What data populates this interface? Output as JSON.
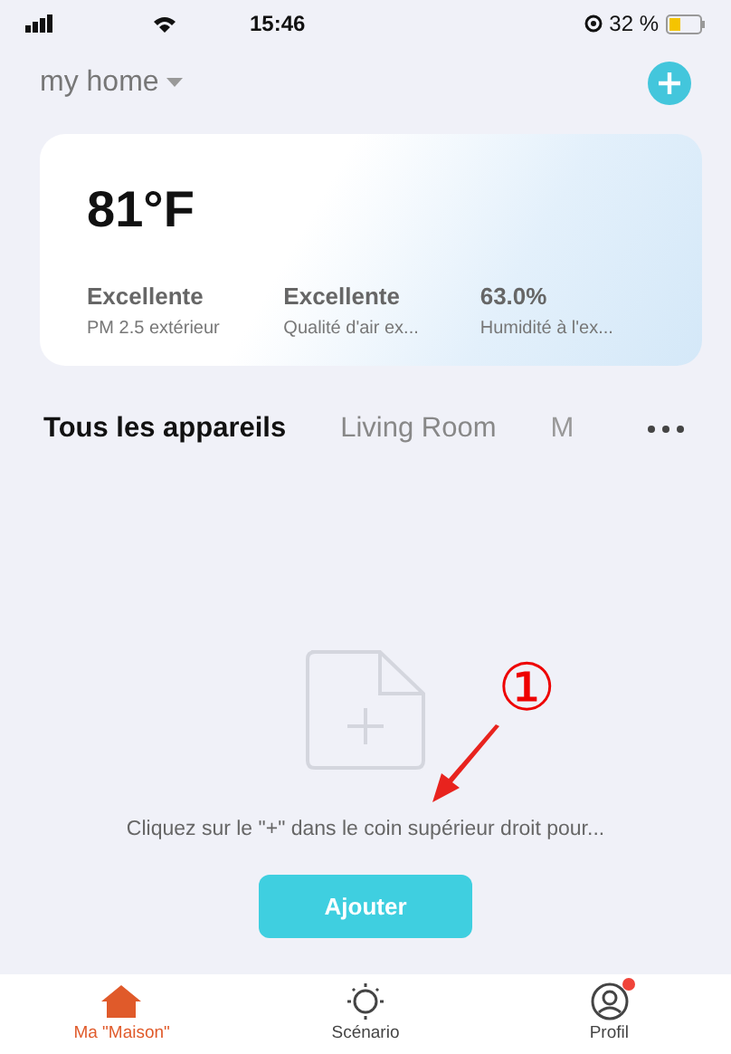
{
  "status_bar": {
    "time": "15:46",
    "battery": "32 %"
  },
  "header": {
    "home_name": "my home"
  },
  "weather_card": {
    "temperature": "81°F",
    "metrics": [
      {
        "value": "Excellente",
        "label": "PM 2.5 extérieur"
      },
      {
        "value": "Excellente",
        "label": "Qualité d'air ex..."
      },
      {
        "value": "63.0%",
        "label": "Humidité à l'ex..."
      }
    ]
  },
  "room_tabs": [
    {
      "label": "Tous les appareils",
      "selected": true
    },
    {
      "label": "Living Room",
      "selected": false
    },
    {
      "label": "M",
      "selected": false
    }
  ],
  "empty_state": {
    "message": "Cliquez sur le \"+\" dans le coin supérieur droit pour...",
    "button": "Ajouter"
  },
  "annotation": {
    "label": "①"
  },
  "bottom_nav": [
    {
      "label": "Ma \"Maison\"",
      "kind": "home",
      "selected": true,
      "badge": false
    },
    {
      "label": "Scénario",
      "kind": "scene",
      "selected": false,
      "badge": false
    },
    {
      "label": "Profil",
      "kind": "profile",
      "selected": false,
      "badge": true
    }
  ]
}
